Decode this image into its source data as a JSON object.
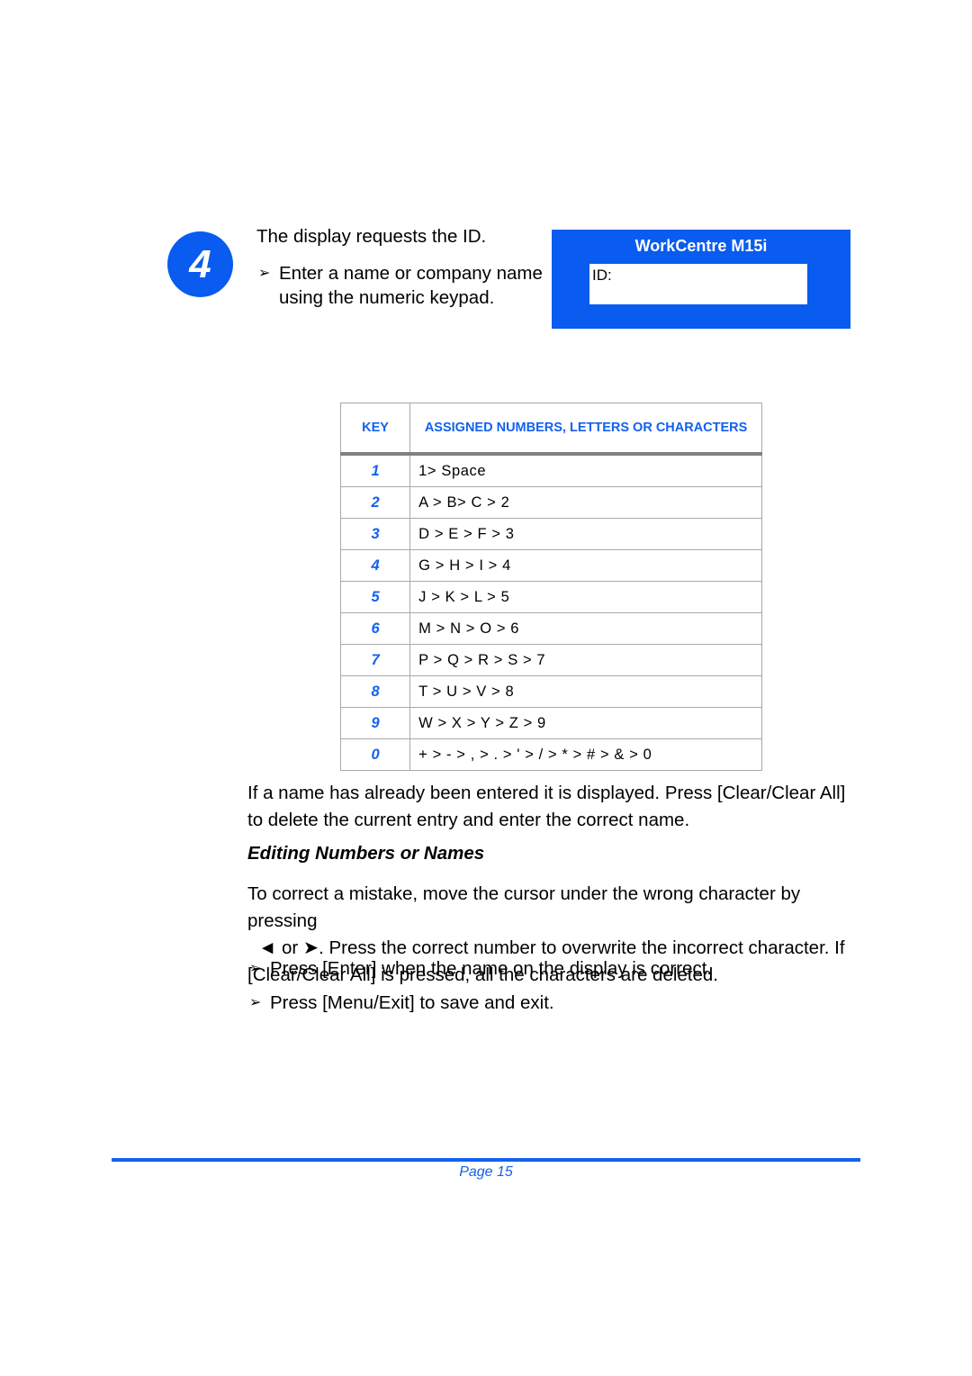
{
  "step": {
    "number": "4",
    "lead_text": "The display requests the ID.",
    "bullet_marker": "➢",
    "bullets": [
      "Enter a name or company name using the numeric keypad."
    ]
  },
  "lcd": {
    "title": "WorkCentre M15i",
    "screen_label": "ID:",
    "screen_value": "",
    "panel_color": "#0A5BEF"
  },
  "key_table": {
    "headers": {
      "key": "KEY",
      "assigned": "ASSIGNED NUMBERS, LETTERS OR CHARACTERS"
    },
    "header_color": "#1361EF",
    "rows": [
      {
        "key": "1",
        "assigned": "1> Space"
      },
      {
        "key": "2",
        "assigned": "A > B> C > 2"
      },
      {
        "key": "3",
        "assigned": "D > E > F > 3"
      },
      {
        "key": "4",
        "assigned": "G > H > I > 4"
      },
      {
        "key": "5",
        "assigned": "J > K > L > 5"
      },
      {
        "key": "6",
        "assigned": "M > N > O > 6"
      },
      {
        "key": "7",
        "assigned": "P > Q > R > S > 7"
      },
      {
        "key": "8",
        "assigned": "T > U > V > 8"
      },
      {
        "key": "9",
        "assigned": "W > X > Y > Z > 9"
      },
      {
        "key": "0",
        "assigned": "+ > - > , > . > ' > / > * > # > & > 0"
      }
    ]
  },
  "body": {
    "paragraph_entered": "If a name has already been entered it is displayed. Press [Clear/Clear All] to delete the current entry and enter the correct name.",
    "heading_editing": "Editing Numbers or Names",
    "paragraph_correct_line1": "To correct a mistake, move the cursor under the wrong character by pressing",
    "paragraph_correct_line2_prefix": "◄ or ➤. Press the correct number to overwrite the incorrect character. If",
    "paragraph_correct_line3": "[Clear/Clear All] is pressed, all the characters are deleted.",
    "arrow_left": "◄",
    "arrow_right": "➤",
    "final_bullets": [
      "Press [Enter] when the name on the display is correct.",
      "Press [Menu/Exit] to save and exit."
    ]
  },
  "footer": {
    "page_label": "Page 15",
    "rule_color": "#1361EF"
  }
}
